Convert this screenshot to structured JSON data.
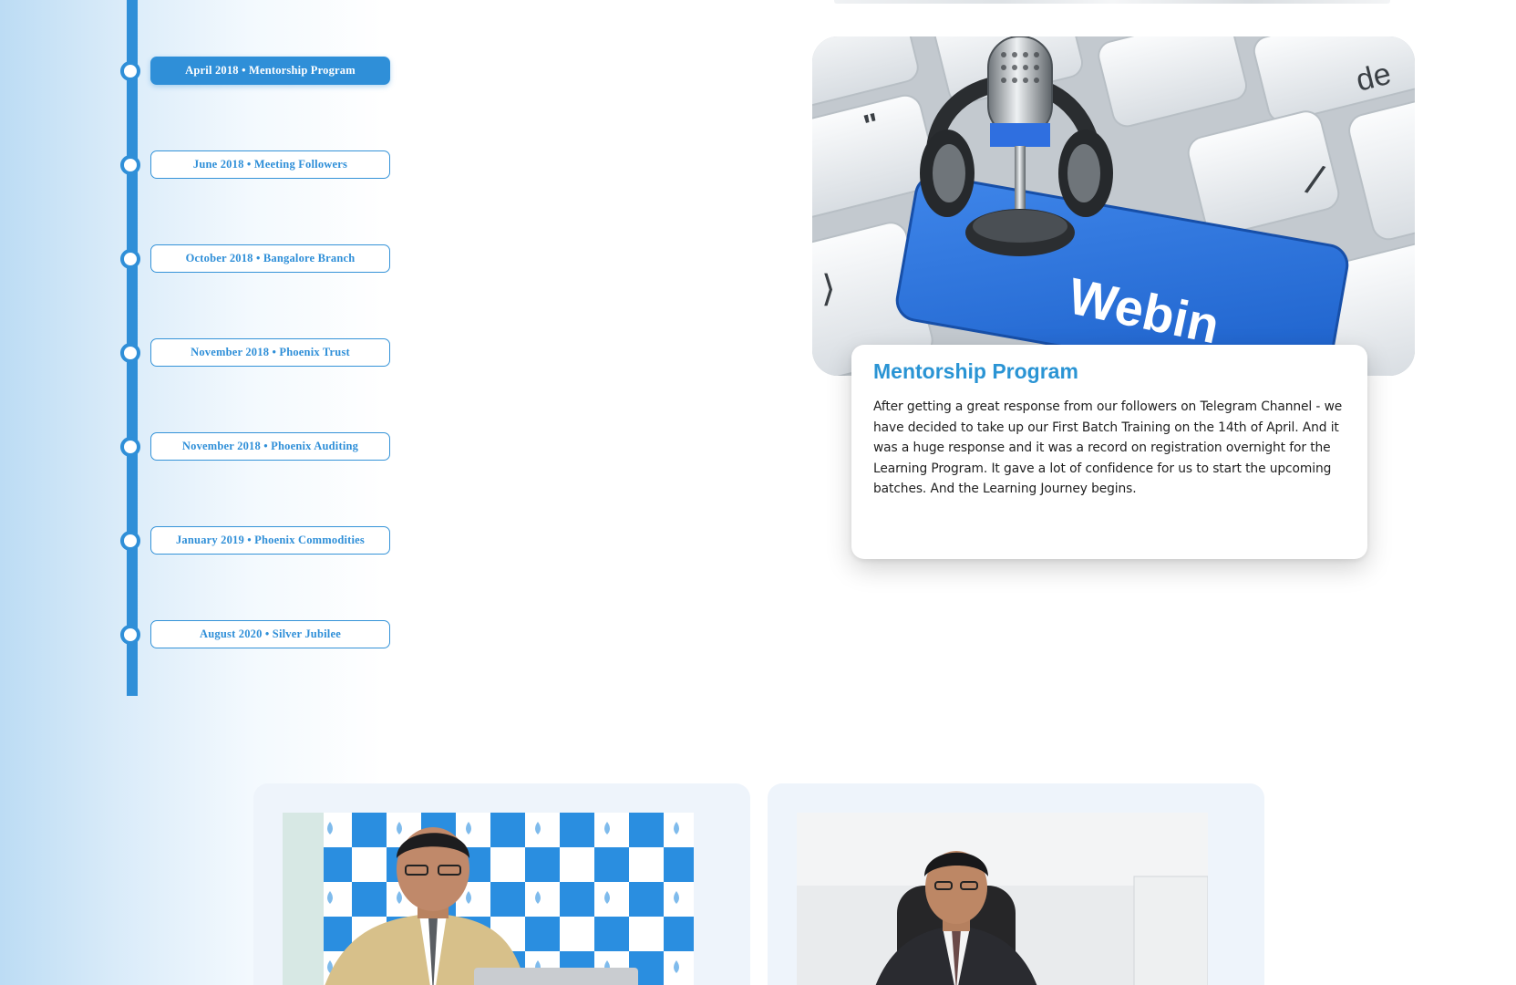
{
  "timeline": {
    "items": [
      {
        "label": "April 2018 • Mentorship Program",
        "active": true
      },
      {
        "label": "June 2018 • Meeting Followers",
        "active": false
      },
      {
        "label": "October 2018 • Bangalore Branch",
        "active": false
      },
      {
        "label": "November 2018 • Phoenix Trust",
        "active": false
      },
      {
        "label": "November 2018 • Phoenix Auditing",
        "active": false
      },
      {
        "label": "January 2019 • Phoenix Commodities",
        "active": false
      },
      {
        "label": "August 2020 • Silver Jubilee",
        "active": false
      }
    ]
  },
  "feature": {
    "image_icon": "microphone-headphones-keyboard-icon",
    "key_label": "Webin",
    "title": "Mentorship Program",
    "description": "After getting a great response from our followers on Telegram Channel - we have decided to take up our First Batch Training on the 14th of April. And it was a huge response and it was a record on registration overnight for the Learning Program. It gave a lot of confidence for us to start the upcoming batches. And the Learning Journey begins."
  },
  "colors": {
    "accent": "#2f8fd8",
    "title_blue": "#2a94d4",
    "card_bg": "#eef4fb"
  }
}
